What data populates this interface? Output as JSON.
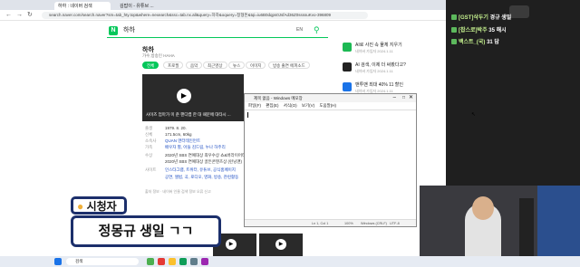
{
  "browser": {
    "tabs": [
      "하하 : 네이버 검색",
      "김밥이 - 유튜브 ..."
    ],
    "url": "search.naver.com/search.naver?sm=tab_hty.top&where=nexearch&ssc=tab.nx.all&query=하하&oquery=정형돈&tqi=iu6B0dqps0JsfAd36Z0ssssuKvo-396809",
    "query": "하하",
    "lang": "EN",
    "profile_name": "하하",
    "profile_sub": "가수,방송인 HAHA",
    "chips": [
      "전체",
      "프로필",
      "음악",
      "최근영상",
      "뉴스",
      "이미지",
      "방송 출연 에피소드"
    ],
    "video_caption": "사이즈 엄마가 미 준 핸디캡 한 대 때문에 대타시 ...",
    "info": [
      {
        "k": "출생",
        "v": "1979. 8. 20."
      },
      {
        "k": "신체",
        "v": "171.5cm, 60kg"
      },
      {
        "k": "소속사",
        "v": "QUAN 엔터테인먼트",
        "link": true
      },
      {
        "k": "가족",
        "v": "배우자 별, 아들 김드림, 누나 하주리",
        "link": true
      },
      {
        "k": "수상",
        "v": "2020년 SBS 연예대상 최우수상 쇼&버라이어티"
      },
      {
        "k": "",
        "v": "2020년 SBS 연예대상 골든콘텐츠상 (런닝맨)"
      },
      {
        "k": "사이트",
        "v": "인스타그램, 트위터, 유튜브, 공식홈페이지",
        "link": true
      },
      {
        "k": "",
        "v": "공연, 앨범, 곡, 로디오, 영화, 방송, 관련활동",
        "link": true
      }
    ],
    "footer_note": "출처 정보 · 네이버 인물 검색 정보 오류 신고",
    "side_items": [
      {
        "title": "AI로 사진 속 물체 지우기",
        "sub": "네이버 가입자 2024.1.11",
        "color": "#1db954"
      },
      {
        "title": "AI 검색, 이제 더 써봤다고?",
        "sub": "네이버 가입자 2024.1.11",
        "color": "#222222"
      },
      {
        "title": "맨투맨 최대 40% 11 할인",
        "sub": "네이버 가입자 2024.1.11",
        "color": "#1a73e8"
      }
    ]
  },
  "notepad": {
    "title": "제목 없음 - Windows 메모장",
    "menu": "파일(F) 편집(E) 서식(O) 보기(V) 도움말(H)",
    "status": [
      "Ln 1, Col 1",
      "100%",
      "Windows (CRLF)",
      "UTF-8"
    ]
  },
  "stream": {
    "chat": [
      {
        "user": "[GST]삭두기",
        "msg": "경규 생일"
      },
      {
        "user": "[찹스로]박주",
        "msg": "35 해시"
      },
      {
        "user": "백스트_(국)",
        "msg": "31 답"
      }
    ],
    "viewer_tag": "시청자",
    "viewer_msg": "정몽규 생일 ㄱㄱ"
  },
  "taskbar": {
    "search": "검색"
  }
}
